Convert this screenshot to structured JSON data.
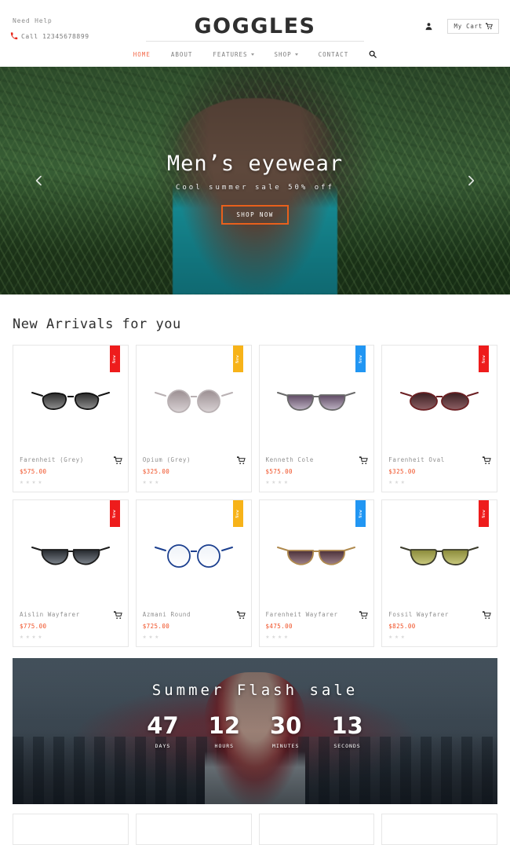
{
  "header": {
    "need_help": "Need Help",
    "phone_icon": "phone-icon",
    "call": "Call 12345678899",
    "brand": "GOGGLES",
    "user_icon": "user-icon",
    "cart_label": "My Cart",
    "cart_icon": "cart-icon",
    "search_icon": "search-icon",
    "nav": [
      {
        "label": "HOME",
        "has_caret": false
      },
      {
        "label": "ABOUT",
        "has_caret": false
      },
      {
        "label": "FEATURES",
        "has_caret": true
      },
      {
        "label": "SHOP",
        "has_caret": true
      },
      {
        "label": "CONTACT",
        "has_caret": false
      }
    ]
  },
  "hero": {
    "title": "Men’s eyewear",
    "subtitle": "Cool summer sale 50% off",
    "button": "SHOP NOW",
    "prev_icon": "chevron-left-icon",
    "next_icon": "chevron-right-icon",
    "button_border_color": "#e8601c"
  },
  "arrivals": {
    "title": "New Arrivals for you",
    "badge_text": "New",
    "products": [
      {
        "name": "Farenheit (Grey)",
        "price": "$575.00",
        "stars": 4,
        "badge_color": "#ee1c1c",
        "style": "cat-eye-black"
      },
      {
        "name": "Opium (Grey)",
        "price": "$325.00",
        "stars": 3,
        "badge_color": "#f7b319",
        "style": "rimless-grey"
      },
      {
        "name": "Kenneth Cole",
        "price": "$575.00",
        "stars": 4,
        "badge_color": "#2196f3",
        "style": "aviator-purple"
      },
      {
        "name": "Farenheit Oval",
        "price": "$325.00",
        "stars": 3,
        "badge_color": "#ee1c1c",
        "style": "oval-maroon"
      },
      {
        "name": "Aislin Wayfarer",
        "price": "$775.00",
        "stars": 4,
        "badge_color": "#ee1c1c",
        "style": "wayfarer-black"
      },
      {
        "name": "Azmani Round",
        "price": "$725.00",
        "stars": 3,
        "badge_color": "#f7b319",
        "style": "round-blue"
      },
      {
        "name": "Farenheit Wayfarer",
        "price": "$475.00",
        "stars": 4,
        "badge_color": "#2196f3",
        "style": "clubmaster-tortoise"
      },
      {
        "name": "Fossil Wayfarer",
        "price": "$825.00",
        "stars": 3,
        "badge_color": "#ee1c1c",
        "style": "aviator-olive"
      }
    ],
    "cart_icon": "cart-icon",
    "star_icon": "star-icon",
    "price_color": "#f04e23"
  },
  "flash_sale": {
    "title": "Summer Flash sale",
    "counters": [
      {
        "value": "47",
        "label": "DAYS"
      },
      {
        "value": "12",
        "label": "HOURS"
      },
      {
        "value": "30",
        "label": "MINUTES"
      },
      {
        "value": "13",
        "label": "SECONDS"
      }
    ]
  }
}
